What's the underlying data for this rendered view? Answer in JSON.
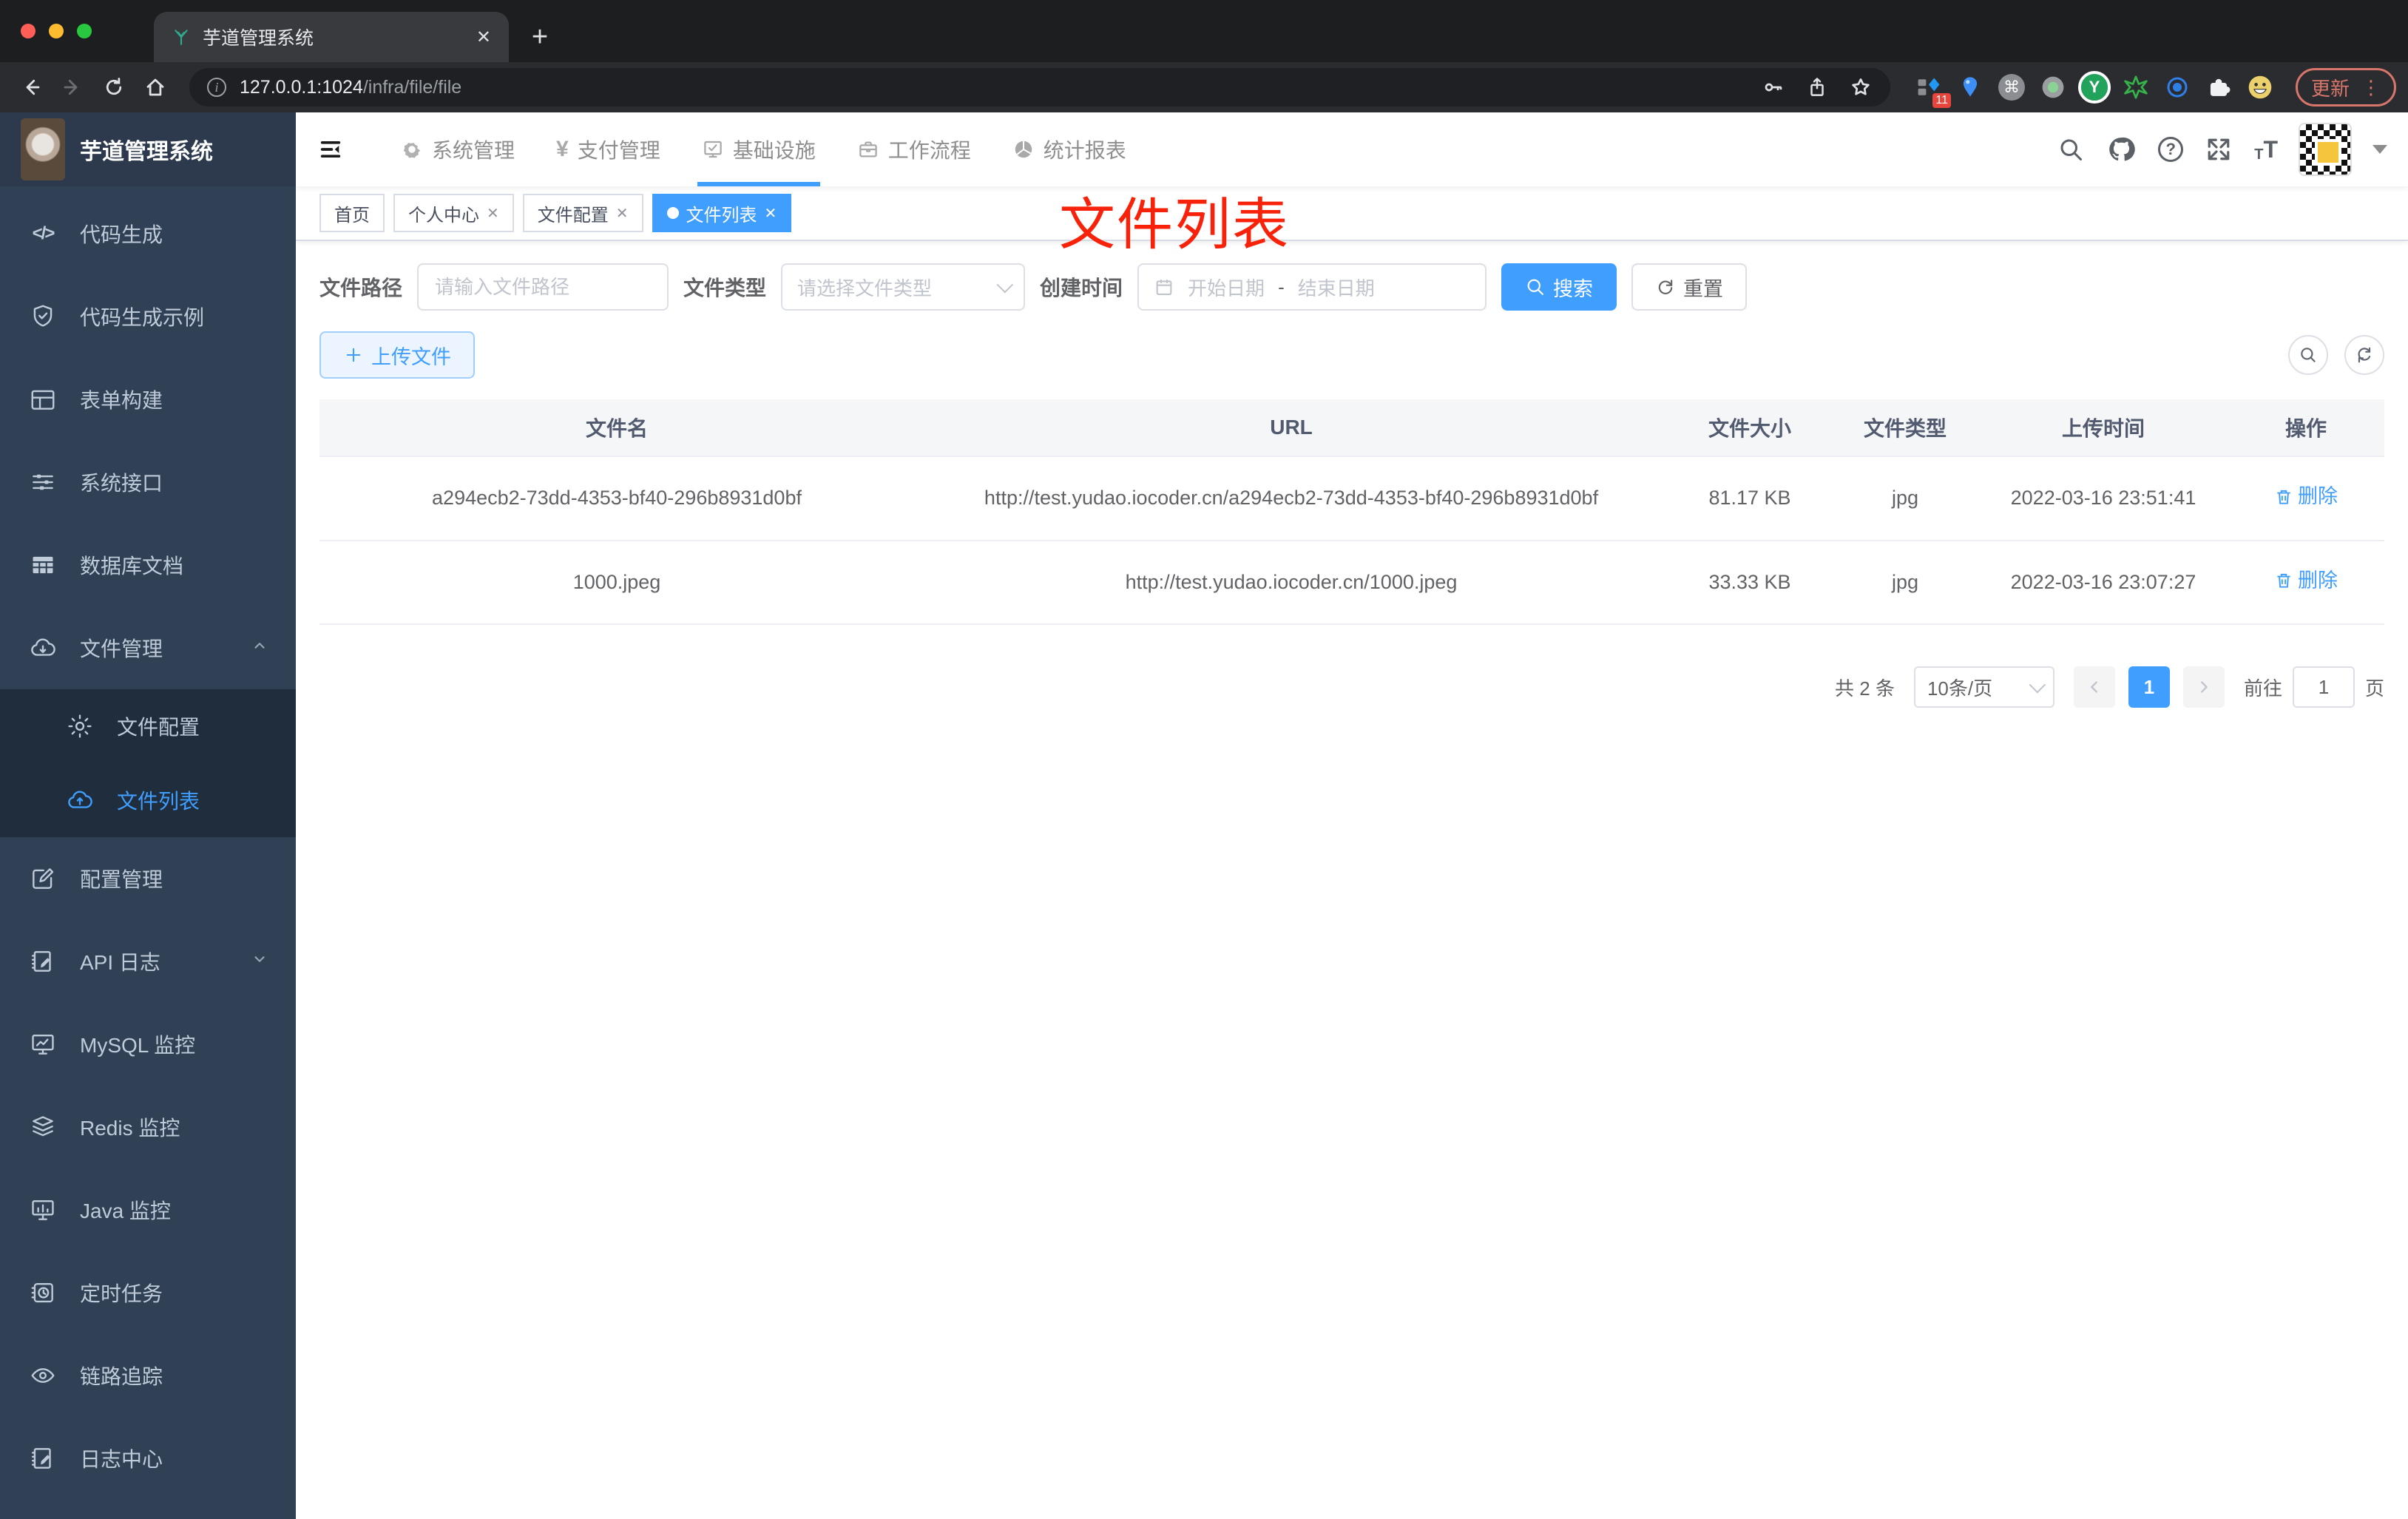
{
  "browser": {
    "tab_title": "芋道管理系统",
    "url_host": "127.0.0.1:1024",
    "url_path": "/infra/file/file",
    "update_label": "更新",
    "extension_badge": "11",
    "extension_icons": [
      "grid-diamond-icon",
      "balloon-icon",
      "command-circle-icon",
      "record-circle-icon",
      "y-circle-icon",
      "green-star-icon",
      "blue-eye-icon",
      "puzzle-icon",
      "emoji-icon"
    ]
  },
  "icons": {
    "close": "✕",
    "plus": "+",
    "code": "</>",
    "yen": "¥",
    "question": "?",
    "command": "⌘",
    "font_small": "T",
    "font_big": "T",
    "info": "i",
    "dots": "⋮",
    "y": "Y"
  },
  "header": {
    "nav": [
      {
        "label": "系统管理",
        "icon": "gear-icon"
      },
      {
        "label": "支付管理",
        "icon": "yen-icon"
      },
      {
        "label": "基础设施",
        "icon": "monitor-check-icon",
        "active": true
      },
      {
        "label": "工作流程",
        "icon": "briefcase-icon"
      },
      {
        "label": "统计报表",
        "icon": "pie-chart-icon"
      }
    ]
  },
  "sidebar": {
    "title": "芋道管理系统",
    "items": [
      {
        "label": "代码生成",
        "icon": "code-icon"
      },
      {
        "label": "代码生成示例",
        "icon": "shield-check-icon"
      },
      {
        "label": "表单构建",
        "icon": "form-icon"
      },
      {
        "label": "系统接口",
        "icon": "sliders-icon"
      },
      {
        "label": "数据库文档",
        "icon": "table-grid-icon"
      },
      {
        "label": "文件管理",
        "icon": "cloud-download-icon",
        "expanded": true
      },
      {
        "label": "文件配置",
        "icon": "gear-icon",
        "submenu": true
      },
      {
        "label": "文件列表",
        "icon": "cloud-upload-icon",
        "submenu": true,
        "active": true
      },
      {
        "label": "配置管理",
        "icon": "edit-square-icon"
      },
      {
        "label": "API 日志",
        "icon": "doc-edit-icon",
        "collapsible": true
      },
      {
        "label": "MySQL 监控",
        "icon": "monitor-chart-icon"
      },
      {
        "label": "Redis 监控",
        "icon": "layers-icon"
      },
      {
        "label": "Java 监控",
        "icon": "monitor-bars-icon"
      },
      {
        "label": "定时任务",
        "icon": "schedule-icon"
      },
      {
        "label": "链路追踪",
        "icon": "eye-icon"
      },
      {
        "label": "日志中心",
        "icon": "doc-edit-icon"
      }
    ]
  },
  "tags": [
    {
      "label": "首页",
      "closable": false,
      "active": false
    },
    {
      "label": "个人中心",
      "closable": true,
      "active": false
    },
    {
      "label": "文件配置",
      "closable": true,
      "active": false
    },
    {
      "label": "文件列表",
      "closable": true,
      "active": true
    }
  ],
  "filters": {
    "path_label": "文件路径",
    "path_placeholder": "请输入文件路径",
    "type_label": "文件类型",
    "type_placeholder": "请选择文件类型",
    "time_label": "创建时间",
    "start_placeholder": "开始日期",
    "range_separator": "-",
    "end_placeholder": "结束日期",
    "search_label": "搜索",
    "reset_label": "重置"
  },
  "toolbar": {
    "upload_label": "上传文件"
  },
  "table": {
    "columns": [
      "文件名",
      "URL",
      "文件大小",
      "文件类型",
      "上传时间",
      "操作"
    ],
    "rows": [
      {
        "name": "a294ecb2-73dd-4353-bf40-296b8931d0bf",
        "url": "http://test.yudao.iocoder.cn/a294ecb2-73dd-4353-bf40-296b8931d0bf",
        "size": "81.17 KB",
        "type": "jpg",
        "time": "2022-03-16 23:51:41",
        "action": "删除"
      },
      {
        "name": "1000.jpeg",
        "url": "http://test.yudao.iocoder.cn/1000.jpeg",
        "size": "33.33 KB",
        "type": "jpg",
        "time": "2022-03-16 23:07:27",
        "action": "删除"
      }
    ]
  },
  "pagination": {
    "total": "共 2 条",
    "page_size": "10条/页",
    "page": "1",
    "goto_label": "前往",
    "goto_value": "1",
    "unit": "页"
  },
  "annotation": {
    "text": "文件列表",
    "color": "#f8220a"
  },
  "colors": {
    "accent": "#409eff",
    "sidebar_bg": "#304156",
    "submenu_bg": "#1f2d3d",
    "tag_active": "#409eff",
    "annotation": "#f8220a",
    "table_header_bg": "#f5f6f8"
  }
}
